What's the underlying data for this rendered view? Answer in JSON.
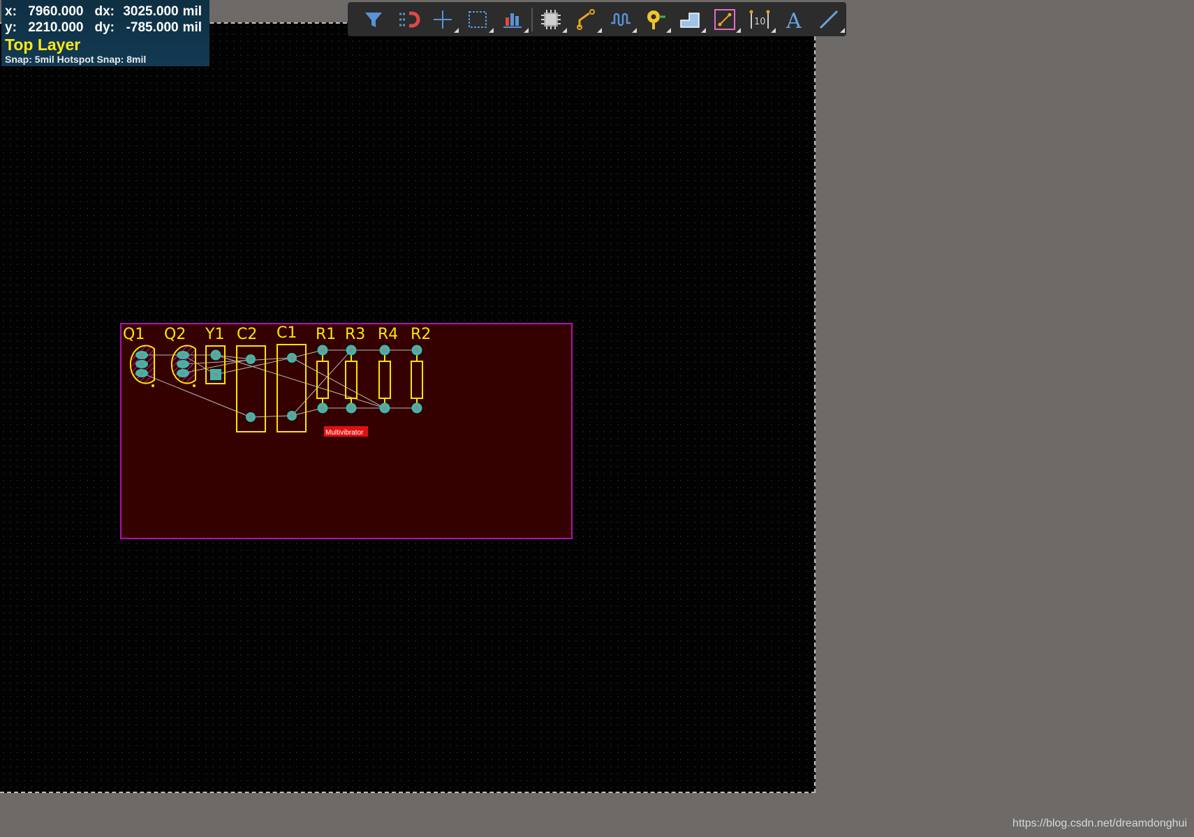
{
  "hud": {
    "x_label": "x:",
    "x_value": "7960.000",
    "dx_label": "dx:",
    "dx_value": "3025.000",
    "y_label": "y:",
    "y_value": "2210.000",
    "dy_label": "dy:",
    "dy_value": "-785.000",
    "unit": "mil",
    "layer": "Top Layer",
    "snap": "Snap: 5mil Hotspot Snap: 8mil"
  },
  "toolbar": {
    "tools": [
      {
        "icon": "filter-icon",
        "has_menu": false
      },
      {
        "icon": "interactive-route-magnet-icon",
        "has_menu": false
      },
      {
        "icon": "move-crosshair-icon",
        "has_menu": true
      },
      {
        "icon": "select-rectangle-icon",
        "has_menu": true
      },
      {
        "icon": "align-bars-icon",
        "has_menu": true
      },
      {
        "icon": "component-chip-icon",
        "has_menu": true
      },
      {
        "icon": "route-track-icon",
        "has_menu": true
      },
      {
        "icon": "length-tuning-icon",
        "has_menu": true
      },
      {
        "icon": "via-pad-icon",
        "has_menu": true
      },
      {
        "icon": "polygon-pour-icon",
        "has_menu": true
      },
      {
        "icon": "place-line-icon",
        "has_menu": true
      },
      {
        "icon": "dimension-icon",
        "has_menu": true
      },
      {
        "icon": "text-string-icon",
        "has_menu": false
      },
      {
        "icon": "line-icon",
        "has_menu": true
      }
    ]
  },
  "pcb": {
    "components": [
      {
        "designator": "Q1"
      },
      {
        "designator": "Q2"
      },
      {
        "designator": "Y1"
      },
      {
        "designator": "C2"
      },
      {
        "designator": "C1"
      },
      {
        "designator": "R1"
      },
      {
        "designator": "R3"
      },
      {
        "designator": "R4"
      },
      {
        "designator": "R2"
      }
    ],
    "net_label": "Multivibrator",
    "colors": {
      "board_fill": "#350000",
      "board_outline": "#b010b0",
      "silkscreen": "#ffe400",
      "pad": "#3fb6a8",
      "hole": "#8a8a8a",
      "ratsnest": "#b9b9b9",
      "label_bg": "#e01010"
    }
  },
  "watermark": "https://blog.csdn.net/dreamdonghui"
}
